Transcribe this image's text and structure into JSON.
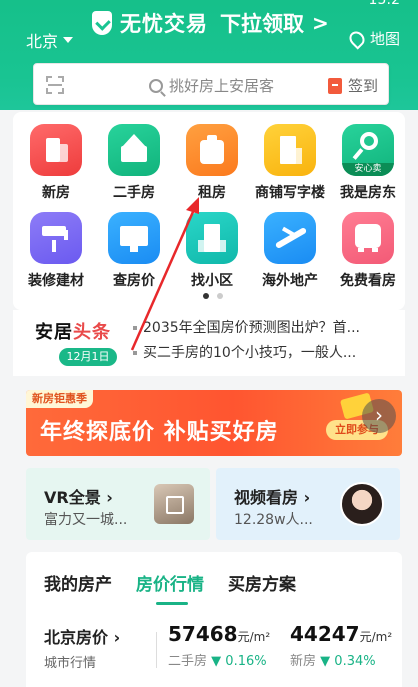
{
  "status": {
    "time": "15:2"
  },
  "header": {
    "city": "北京",
    "promo_main": "无忧交易",
    "promo_sub": "下拉领取",
    "promo_arrow": ">",
    "map_label": "地图"
  },
  "search": {
    "placeholder": "挑好房上安居客",
    "checkin_label": "签到"
  },
  "grid": {
    "items": [
      {
        "label": "新房",
        "icon": "new-house-icon"
      },
      {
        "label": "二手房",
        "icon": "second-hand-house-icon"
      },
      {
        "label": "租房",
        "icon": "rent-suitcase-icon"
      },
      {
        "label": "商铺写字楼",
        "icon": "office-building-icon"
      },
      {
        "label": "我是房东",
        "icon": "landlord-key-icon",
        "badge": "安心卖"
      },
      {
        "label": "装修建材",
        "icon": "paint-roller-icon"
      },
      {
        "label": "查房价",
        "icon": "price-chart-icon"
      },
      {
        "label": "找小区",
        "icon": "community-building-icon"
      },
      {
        "label": "海外地产",
        "icon": "airplane-icon"
      },
      {
        "label": "免费看房",
        "icon": "bus-icon"
      }
    ]
  },
  "news": {
    "logo_left": "安居",
    "logo_right": "头条",
    "date": "12月1日",
    "items": [
      "2035年全国房价预测图出炉？首...",
      "买二手房的10个小技巧，一般人..."
    ]
  },
  "banner": {
    "tag": "新房钜惠季",
    "title": "年终探底价 补贴买好房",
    "button": "立即参与",
    "next": "›"
  },
  "vr_card": {
    "title": "VR全景",
    "arrow": "›",
    "subtitle": "富力又一城..."
  },
  "video_card": {
    "title": "视频看房",
    "arrow": "›",
    "subtitle": "12.28w人..."
  },
  "bottom": {
    "tabs": [
      "我的房产",
      "房价行情",
      "买房方案"
    ],
    "active_tab": 1,
    "price_city": "北京房价",
    "price_arrow": "›",
    "price_sub": "城市行情",
    "second_hand": {
      "value": "57468",
      "unit": "元/m²",
      "label": "二手房",
      "change": "0.16%"
    },
    "new_house": {
      "value": "44247",
      "unit": "元/m²",
      "label": "新房",
      "change": "0.34%"
    }
  },
  "colors": {
    "brand": "#19c492",
    "accent_green": "#19b386",
    "banner": "#ff5530",
    "arrow": "#e8282b"
  }
}
